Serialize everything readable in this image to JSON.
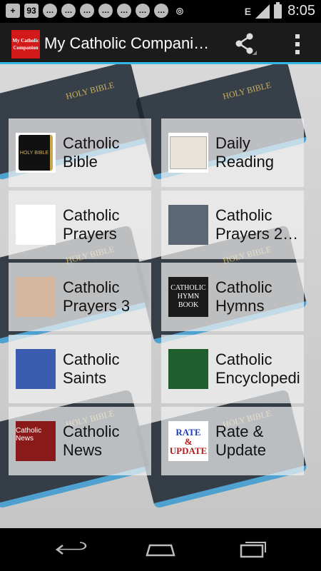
{
  "status_bar": {
    "time": "8:05",
    "network": "E",
    "icons": [
      "plus-icon",
      "counter-icon",
      "chat-icon",
      "chat-icon",
      "chat-icon",
      "chat-icon",
      "chat-icon",
      "chat-icon",
      "chat-icon",
      "eye-icon"
    ],
    "counter_label": "93"
  },
  "action_bar": {
    "app_icon_line1": "My Catholic",
    "app_icon_line2": "Companion",
    "title": "My Catholic Compani…"
  },
  "menu": {
    "items": [
      {
        "label": "Catholic\nBible",
        "icon": "bible-icon",
        "thumb_text": "HOLY BIBLE"
      },
      {
        "label": "Daily\nReading",
        "icon": "rosary-icon",
        "thumb_text": ""
      },
      {
        "label": "Catholic\nPrayers",
        "icon": "praying-hands-icon",
        "thumb_text": ""
      },
      {
        "label": "Catholic\nPrayers 2…",
        "icon": "praying-hands-photo-icon",
        "thumb_text": ""
      },
      {
        "label": "Catholic\nPrayers 3",
        "icon": "prayer-hands-icon",
        "thumb_text": ""
      },
      {
        "label": "Catholic\nHymns",
        "icon": "hymn-book-icon",
        "thumb_text": "CATHOLIC HYMN BOOK"
      },
      {
        "label": "Catholic\nSaints",
        "icon": "mary-icon",
        "thumb_text": ""
      },
      {
        "label": "Catholic\nEncyclopedi",
        "icon": "encyclopedia-icon",
        "thumb_text": ""
      },
      {
        "label": "Catholic\nNews",
        "icon": "news-icon",
        "thumb_text": "Catholic News"
      },
      {
        "label": "Rate &\nUpdate",
        "icon": "rate-icon",
        "thumb_text_1": "RATE",
        "thumb_text_2": "&",
        "thumb_text_3": "UPDATE"
      }
    ]
  },
  "colors": {
    "accent": "#33b5e5",
    "actionbar": "#1b1b1b",
    "app_icon": "#d21a1a"
  }
}
